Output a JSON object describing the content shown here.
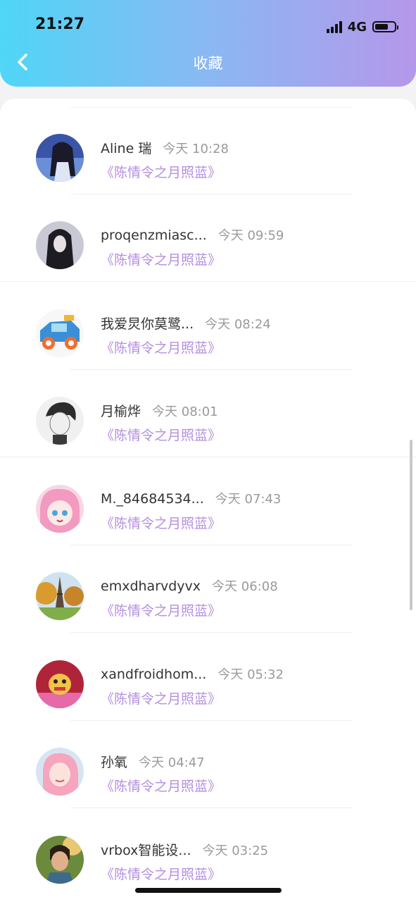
{
  "status_bar": {
    "time": "21:27",
    "network": "4G",
    "battery_level": 0.7
  },
  "header": {
    "title": "收藏",
    "back_icon": "chevron-left-icon"
  },
  "favorites": [
    {
      "username": "Aline 瑞",
      "time": "今天 10:28",
      "work": "《陈情令之月照蓝》",
      "avatar": "anime-girl-dark-hair"
    },
    {
      "username": "proqenzmiasc...",
      "time": "今天 09:59",
      "work": "《陈情令之月照蓝》",
      "avatar": "dark-hair-girl"
    },
    {
      "username": "我爱炅你莫鹭...",
      "time": "今天 08:24",
      "work": "《陈情令之月照蓝》",
      "avatar": "toy-car"
    },
    {
      "username": "月榆烨",
      "time": "今天 08:01",
      "work": "《陈情令之月照蓝》",
      "avatar": "sketch-boy"
    },
    {
      "username": "M._84684534...",
      "time": "今天 07:43",
      "work": "《陈情令之月照蓝》",
      "avatar": "pink-anime-girl"
    },
    {
      "username": "emxdharvdyvx",
      "time": "今天 06:08",
      "work": "《陈情令之月照蓝》",
      "avatar": "eiffel-tower"
    },
    {
      "username": "xandfroidhom...",
      "time": "今天 05:32",
      "work": "《陈情令之月照蓝》",
      "avatar": "red-cartoon"
    },
    {
      "username": "孙氧",
      "time": "今天 04:47",
      "work": "《陈情令之月照蓝》",
      "avatar": "pink-hair-girl"
    },
    {
      "username": "vrbox智能设...",
      "time": "今天 03:25",
      "work": "《陈情令之月照蓝》",
      "avatar": "boy-portrait"
    }
  ],
  "colors": {
    "header_gradient_start": "#4fd6f7",
    "header_gradient_end": "#b597ea",
    "work_title": "#b48ee0",
    "time": "#9a9a9a"
  }
}
